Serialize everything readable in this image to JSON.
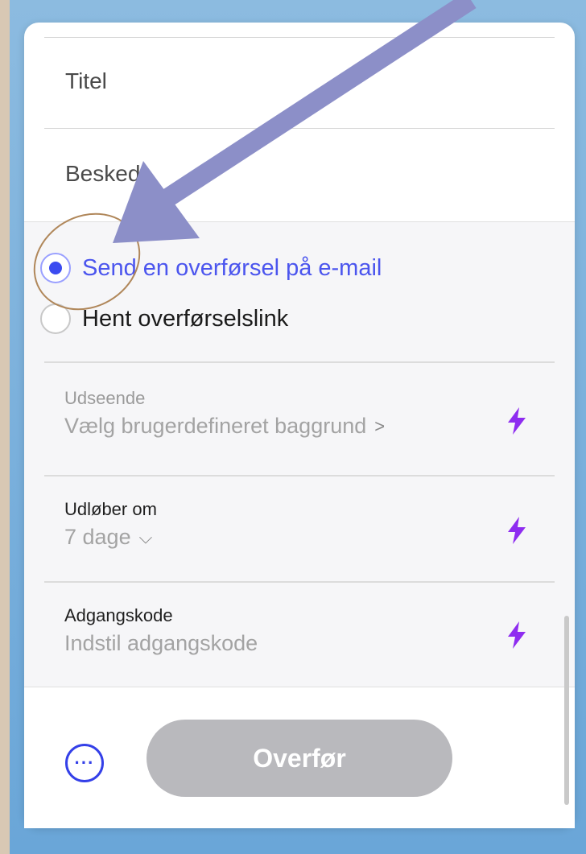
{
  "form": {
    "title_placeholder": "Titel",
    "message_placeholder": "Besked"
  },
  "delivery": {
    "email_option": "Send en overførsel på e-mail",
    "link_option": "Hent overførselslink",
    "selected": "email"
  },
  "settings": {
    "appearance_label": "Udseende",
    "appearance_value": "Vælg brugerdefineret baggrund",
    "appearance_chevron": ">",
    "expires_label": "Udløber om",
    "expires_value": "7 dage",
    "expires_chevron": "⌵",
    "password_label": "Adgangskode",
    "password_value": "Indstil adgangskode"
  },
  "footer": {
    "more_label": "···",
    "transfer_label": "Overfør"
  },
  "icons": {
    "bolt": "lightning-bolt-icon",
    "more": "more-options-icon"
  },
  "colors": {
    "accent": "#3b4bf0",
    "bolt": "#8e2cf0",
    "arrow": "#8c8fc8",
    "circle": "#b0875a",
    "button_disabled": "#b9b9bd"
  }
}
